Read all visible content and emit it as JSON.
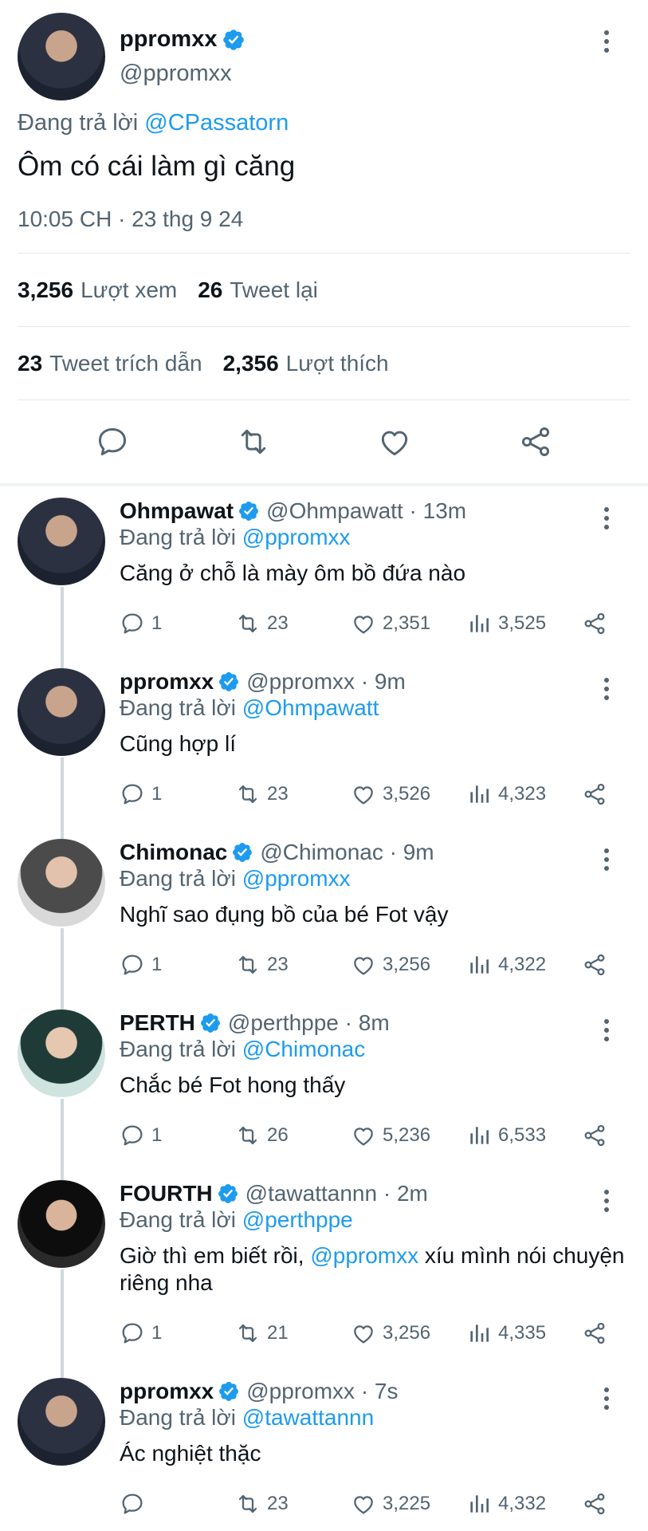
{
  "main_tweet": {
    "name": "ppromxx",
    "handle": "@ppromxx",
    "replying_prefix": "Đang trả lời",
    "replying_to": "@CPassatorn",
    "text": "Ôm có cái làm gì căng",
    "time": "10:05 CH · 23 thg 9 24",
    "views_count": "3,256",
    "views_label": "Lượt xem",
    "retweets_count": "26",
    "retweets_label": "Tweet lại",
    "quotes_count": "23",
    "quotes_label": "Tweet trích dẫn",
    "likes_count": "2,356",
    "likes_label": "Lượt thích"
  },
  "replies": [
    {
      "name": "Ohmpawat",
      "meta": "@Ohmpawatt · 13m",
      "replying_prefix": "Đang trả lời",
      "replying_to": "@ppromxx",
      "text_before": "Căng ở chỗ là mày ôm bồ đứa nào",
      "text_mention": "",
      "text_after": "",
      "replies": "1",
      "retweets": "23",
      "likes": "2,351",
      "views": "3,525"
    },
    {
      "name": "ppromxx",
      "meta": "@ppromxx · 9m",
      "replying_prefix": "Đang trả lời",
      "replying_to": "@Ohmpawatt",
      "text_before": "Cũng hợp lí",
      "text_mention": "",
      "text_after": "",
      "replies": "1",
      "retweets": "23",
      "likes": "3,526",
      "views": "4,323"
    },
    {
      "name": "Chimonac",
      "meta": "@Chimonac · 9m",
      "replying_prefix": "Đang trả lời",
      "replying_to": "@ppromxx",
      "text_before": "Nghĩ sao đụng bồ của bé Fot vậy",
      "text_mention": "",
      "text_after": "",
      "replies": "1",
      "retweets": "23",
      "likes": "3,256",
      "views": "4,322"
    },
    {
      "name": "PERTH",
      "meta": "@perthppe · 8m",
      "replying_prefix": "Đang trả lời",
      "replying_to": "@Chimonac",
      "text_before": "Chắc bé Fot hong thấy",
      "text_mention": "",
      "text_after": "",
      "replies": "1",
      "retweets": "26",
      "likes": "5,236",
      "views": "6,533"
    },
    {
      "name": "FOURTH",
      "meta": "@tawattannn · 2m",
      "replying_prefix": "Đang trả lời",
      "replying_to": "@perthppe",
      "text_before": "Giờ thì em biết rồi, ",
      "text_mention": "@ppromxx",
      "text_after": " xíu mình nói chuyện riêng nha",
      "replies": "1",
      "retweets": "21",
      "likes": "3,256",
      "views": "4,335"
    },
    {
      "name": "ppromxx",
      "meta": "@ppromxx · 7s",
      "replying_prefix": "Đang trả lời",
      "replying_to": "@tawattannn",
      "text_before": "Ác nghiệt thặc",
      "text_mention": "",
      "text_after": "",
      "replies": "",
      "retweets": "23",
      "likes": "3,225",
      "views": "4,332"
    }
  ],
  "colors": {
    "accent": "#1d9bf0",
    "secondary_text": "#536471",
    "thread_line": "#cfd9de"
  }
}
